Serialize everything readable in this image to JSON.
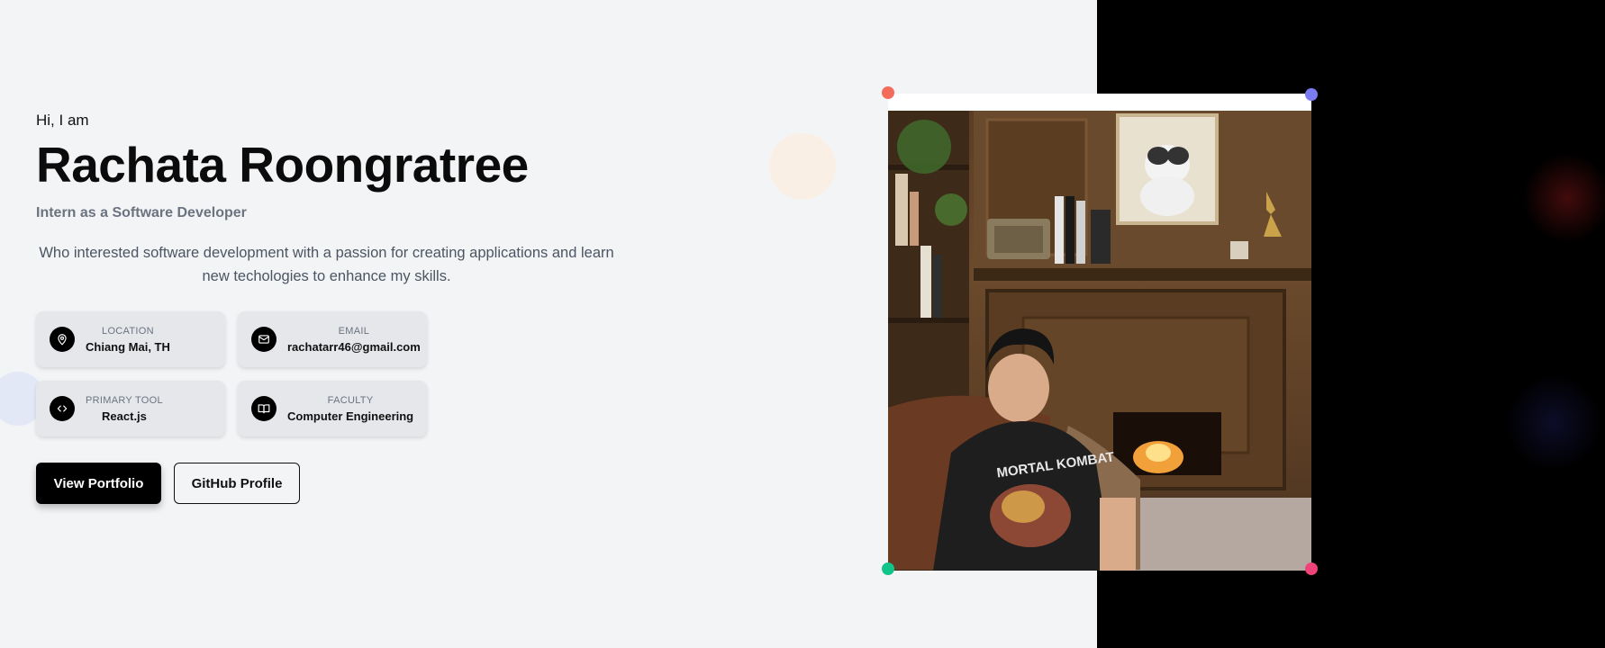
{
  "hero": {
    "greeting": "Hi, I am",
    "name": "Rachata Roongratree",
    "role": "Intern as a Software Developer",
    "description": "Who interested software development with a passion for creating applications and learn new techologies to enhance my skills."
  },
  "info_cards": [
    {
      "icon": "map-pin-icon",
      "label": "LOCATION",
      "value": "Chiang Mai, TH"
    },
    {
      "icon": "mail-icon",
      "label": "EMAIL",
      "value": "rachatarr46@gmail.com"
    },
    {
      "icon": "code-icon",
      "label": "PRIMARY TOOL",
      "value": "React.js"
    },
    {
      "icon": "book-icon",
      "label": "FACULTY",
      "value": "Computer Engineering"
    }
  ],
  "buttons": {
    "primary": "View Portfolio",
    "secondary": "GitHub Profile"
  },
  "photo": {
    "alt": "Portrait photo",
    "shirt_text": "MORTAL KOMBAT"
  },
  "colors": {
    "background": "#f3f4f6",
    "dark_panel": "#000000",
    "dot_top_left": "#f26b5b",
    "dot_top_right": "#7c7cf2",
    "dot_bottom_left": "#10c48a",
    "dot_bottom_right": "#f0437a"
  }
}
